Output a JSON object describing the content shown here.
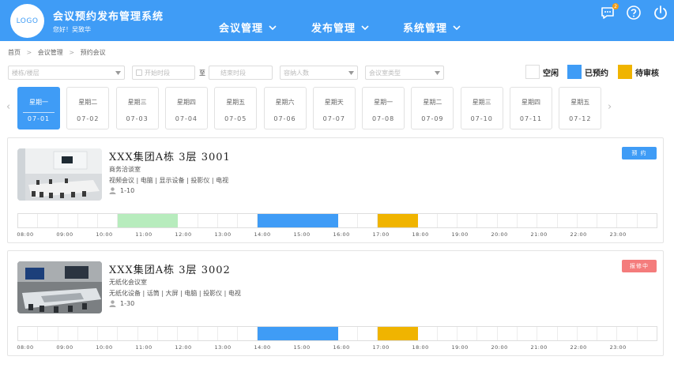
{
  "header": {
    "logo_text": "LOGO",
    "title": "会议预约发布管理系统",
    "greeting": "您好！吴致华",
    "nav": [
      {
        "label": "会议管理"
      },
      {
        "label": "发布管理"
      },
      {
        "label": "系统管理"
      }
    ],
    "message_badge": "2",
    "icons": [
      "message-icon",
      "help-icon",
      "power-icon"
    ]
  },
  "breadcrumb": [
    "首页",
    "会议管理",
    "预约会议"
  ],
  "filters": {
    "building_placeholder": "楼栋/楼层",
    "start_time_placeholder": "开始时段",
    "to_label": "至",
    "end_time_placeholder": "结束时段",
    "capacity_placeholder": "容纳人数",
    "room_type_placeholder": "会议室类型"
  },
  "legend": [
    {
      "label": "空闲",
      "color": "#ffffff"
    },
    {
      "label": "已预约",
      "color": "#3f9cf6"
    },
    {
      "label": "待审核",
      "color": "#f0b400"
    }
  ],
  "dates": [
    {
      "weekday": "星期一",
      "date": "07-01",
      "active": true
    },
    {
      "weekday": "星期二",
      "date": "07-02"
    },
    {
      "weekday": "星期三",
      "date": "07-03"
    },
    {
      "weekday": "星期四",
      "date": "07-04"
    },
    {
      "weekday": "星期五",
      "date": "07-05"
    },
    {
      "weekday": "星期六",
      "date": "07-06"
    },
    {
      "weekday": "星期天",
      "date": "07-07"
    },
    {
      "weekday": "星期一",
      "date": "07-08"
    },
    {
      "weekday": "星期二",
      "date": "07-09"
    },
    {
      "weekday": "星期三",
      "date": "07-10"
    },
    {
      "weekday": "星期四",
      "date": "07-11"
    },
    {
      "weekday": "星期五",
      "date": "07-12"
    }
  ],
  "time_labels": [
    "08:00",
    "09:00",
    "10:00",
    "11:00",
    "12:00",
    "13:00",
    "14:00",
    "15:00",
    "16:00",
    "17:00",
    "18:00",
    "19:00",
    "20:00",
    "21:00",
    "22:00",
    "23:00"
  ],
  "rooms": [
    {
      "name": "XXX集团A栋  3层  3001",
      "type": "商务洽谈室",
      "equipment": "视频会议 | 电脑 | 显示设备 | 投影仪 | 电视",
      "capacity": "1-10",
      "status_label": "预  约",
      "status_color": "#3f9cf6",
      "bookings": [
        {
          "start": "10:30",
          "end": "12:00",
          "status": "selected",
          "color": "#b7ecbd"
        },
        {
          "start": "14:00",
          "end": "16:00",
          "status": "booked",
          "color": "#3f9cf6"
        },
        {
          "start": "17:00",
          "end": "18:00",
          "status": "pending",
          "color": "#f0b400"
        }
      ]
    },
    {
      "name": "XXX集团A栋  3层  3002",
      "type": "无纸化会议室",
      "equipment": "无纸化设备 | 话筒 | 大屏 | 电脑 | 投影仪 | 电视",
      "capacity": "1-30",
      "status_label": "报修中",
      "status_color": "#f47c7c",
      "bookings": [
        {
          "start": "14:00",
          "end": "16:00",
          "status": "booked",
          "color": "#3f9cf6"
        },
        {
          "start": "17:00",
          "end": "18:00",
          "status": "pending",
          "color": "#f0b400"
        }
      ]
    }
  ]
}
